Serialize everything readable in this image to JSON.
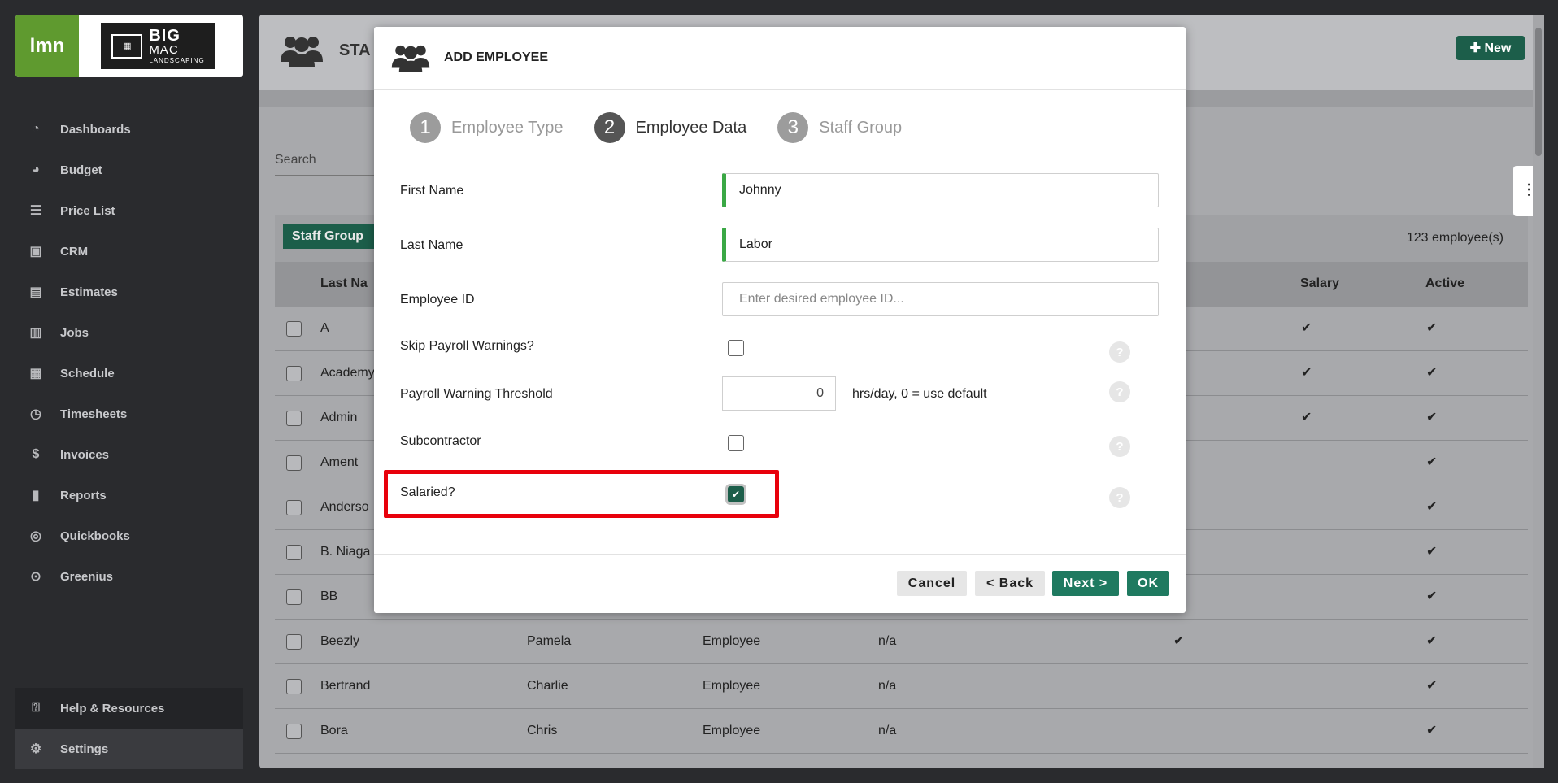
{
  "sidebar": {
    "logo_lmn": "lmn",
    "logo_big": "BIG",
    "logo_mac": "MAC",
    "logo_landscaping": "LANDSCAPING",
    "items": [
      {
        "label": "Dashboards",
        "icon": "gauge-icon"
      },
      {
        "label": "Budget",
        "icon": "pie-chart-icon"
      },
      {
        "label": "Price List",
        "icon": "list-icon"
      },
      {
        "label": "CRM",
        "icon": "contact-card-icon"
      },
      {
        "label": "Estimates",
        "icon": "calculator-icon"
      },
      {
        "label": "Jobs",
        "icon": "building-icon"
      },
      {
        "label": "Schedule",
        "icon": "calendar-icon"
      },
      {
        "label": "Timesheets",
        "icon": "clock-icon"
      },
      {
        "label": "Invoices",
        "icon": "invoice-icon"
      },
      {
        "label": "Reports",
        "icon": "report-icon"
      },
      {
        "label": "Quickbooks",
        "icon": "quickbooks-icon"
      },
      {
        "label": "Greenius",
        "icon": "play-circle-icon"
      }
    ],
    "help_label": "Help & Resources",
    "settings_label": "Settings"
  },
  "main": {
    "title": "STA",
    "new_button": "✚ New",
    "search_placeholder": "Search",
    "staff_group_button": "Staff Group",
    "employee_count": "123  employee(s)",
    "columns": {
      "last_name": "Last Na",
      "salary": "Salary",
      "active": "Active"
    },
    "rows": [
      {
        "last": "A",
        "first": "",
        "type": "",
        "group": "",
        "col5": "",
        "salary": "✔",
        "active": "✔"
      },
      {
        "last": "Academy",
        "first": "",
        "type": "",
        "group": "",
        "col5": "",
        "salary": "✔",
        "active": "✔"
      },
      {
        "last": "Admin",
        "first": "",
        "type": "",
        "group": "",
        "col5": "",
        "salary": "✔",
        "active": "✔"
      },
      {
        "last": "Ament",
        "first": "",
        "type": "",
        "group": "",
        "col5": "",
        "salary": "",
        "active": "✔"
      },
      {
        "last": "Anderso",
        "first": "",
        "type": "",
        "group": "",
        "col5": "",
        "salary": "",
        "active": "✔"
      },
      {
        "last": "B. Niaga",
        "first": "",
        "type": "",
        "group": "",
        "col5": "",
        "salary": "",
        "active": "✔"
      },
      {
        "last": "BB",
        "first": "",
        "type": "",
        "group": "",
        "col5": "",
        "salary": "",
        "active": "✔"
      },
      {
        "last": "Beezly",
        "first": "Pamela",
        "type": "Employee",
        "group": "n/a",
        "col5": "✔",
        "salary": "",
        "active": "✔"
      },
      {
        "last": "Bertrand",
        "first": "Charlie",
        "type": "Employee",
        "group": "n/a",
        "col5": "",
        "salary": "",
        "active": "✔"
      },
      {
        "last": "Bora",
        "first": "Chris",
        "type": "Employee",
        "group": "n/a",
        "col5": "",
        "salary": "",
        "active": "✔"
      }
    ]
  },
  "modal": {
    "title": "ADD EMPLOYEE",
    "steps": [
      {
        "num": "1",
        "label": "Employee Type"
      },
      {
        "num": "2",
        "label": "Employee Data"
      },
      {
        "num": "3",
        "label": "Staff Group"
      }
    ],
    "current_step": 2,
    "fields": {
      "first_name_label": "First Name",
      "first_name_value": "Johnny",
      "last_name_label": "Last Name",
      "last_name_value": "Labor",
      "employee_id_label": "Employee ID",
      "employee_id_placeholder": "Enter desired employee ID...",
      "skip_payroll_label": "Skip Payroll Warnings?",
      "threshold_label": "Payroll Warning Threshold",
      "threshold_value": "0",
      "threshold_note": "hrs/day, 0 = use default",
      "subcontractor_label": "Subcontractor",
      "salaried_label": "Salaried?"
    },
    "help_glyph": "?",
    "buttons": {
      "cancel": "Cancel",
      "back": "< Back",
      "next": "Next >",
      "ok": "OK"
    }
  },
  "colors": {
    "brand_green": "#1c5e4a",
    "valid_green": "#3aa845",
    "highlight_red": "#e8000b"
  }
}
